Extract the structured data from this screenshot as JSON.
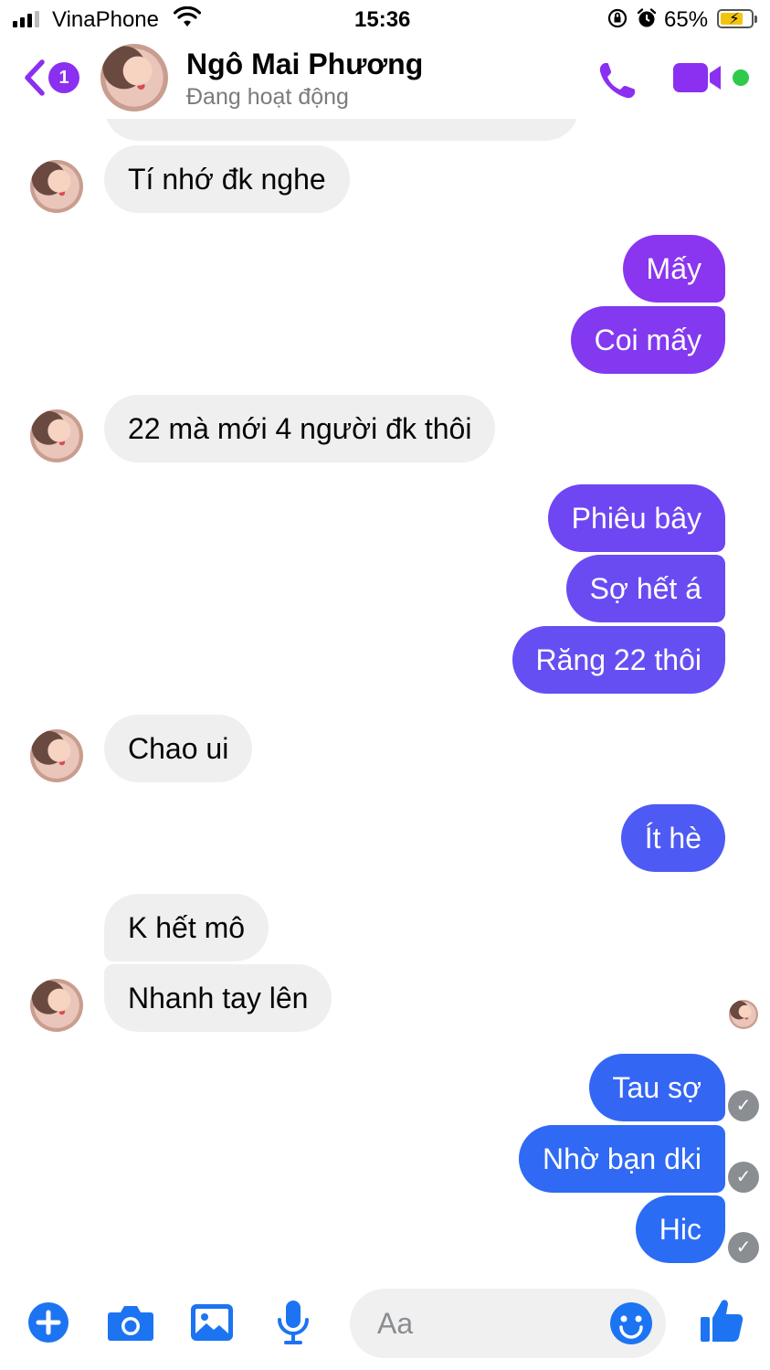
{
  "status_bar": {
    "carrier": "VinaPhone",
    "time": "15:36",
    "battery_percent": "65%",
    "battery_level": 0.65,
    "icons": [
      "signal-icon",
      "wifi-icon",
      "orientation-lock-icon",
      "alarm-icon",
      "battery-charging-icon"
    ]
  },
  "header": {
    "back_badge": "1",
    "contact_name": "Ngô Mai Phương",
    "contact_status": "Đang hoạt động",
    "icons": [
      "back-chevron-icon",
      "phone-icon",
      "video-camera-icon",
      "online-dot-icon"
    ]
  },
  "messages": [
    {
      "side": "in",
      "text": "",
      "partial": true
    },
    {
      "side": "in",
      "text": "Tí nhớ đk nghe"
    },
    {
      "side": "out",
      "text": "Mấy"
    },
    {
      "side": "out",
      "text": "Coi mấy"
    },
    {
      "side": "in",
      "text": "22 mà mới 4 người đk thôi"
    },
    {
      "side": "out",
      "text": "Phiêu bây"
    },
    {
      "side": "out",
      "text": "Sợ hết á"
    },
    {
      "side": "out",
      "text": "Răng 22 thôi"
    },
    {
      "side": "in",
      "text": "Chao ui"
    },
    {
      "side": "out",
      "text": "Ít hè"
    },
    {
      "side": "in",
      "text": "K hết mô"
    },
    {
      "side": "in",
      "text": "Nhanh tay lên"
    },
    {
      "side": "out",
      "text": "Tau sợ",
      "status": "sent"
    },
    {
      "side": "out",
      "text": "Nhờ bạn dki",
      "status": "sent"
    },
    {
      "side": "out",
      "text": "Hic",
      "status": "sent"
    }
  ],
  "composer": {
    "placeholder": "Aa",
    "icons": [
      "plus-icon",
      "camera-icon",
      "gallery-icon",
      "microphone-icon",
      "emoji-icon",
      "thumbs-up-icon"
    ]
  },
  "colors": {
    "accent_purple": "#8b2ff0",
    "bubble_purple": "#8a35f0",
    "bubble_indigo": "#6a4cf2",
    "bubble_blue": "#2f66f4",
    "bubble_incoming": "#efefef",
    "composer_blue": "#1c74f2",
    "online_green": "#2fc94b"
  }
}
